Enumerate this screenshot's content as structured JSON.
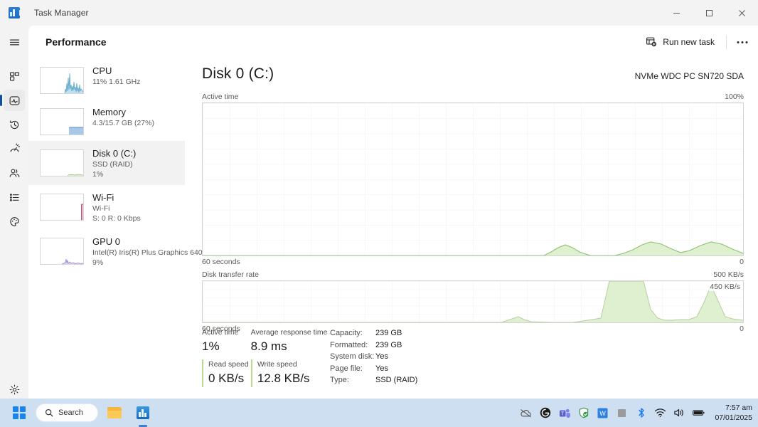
{
  "window": {
    "app_icon": "taskmanager-icon",
    "title": "Task Manager",
    "minimize": "—",
    "maximize": "☐",
    "close": "✕"
  },
  "rail": {
    "items": [
      {
        "name": "hamburger-menu",
        "icon": "hamburger-icon",
        "selected": false
      },
      {
        "name": "processes",
        "icon": "processes-icon",
        "selected": false
      },
      {
        "name": "performance",
        "icon": "performance-icon",
        "selected": true
      },
      {
        "name": "app-history",
        "icon": "history-icon",
        "selected": false
      },
      {
        "name": "startup-apps",
        "icon": "gauge-icon",
        "selected": false
      },
      {
        "name": "users",
        "icon": "users-icon",
        "selected": false
      },
      {
        "name": "details",
        "icon": "list-icon",
        "selected": false
      },
      {
        "name": "services",
        "icon": "services-gear-icon",
        "selected": false
      }
    ],
    "settings": {
      "name": "settings",
      "icon": "settings-gear-icon"
    }
  },
  "header": {
    "page_title": "Performance",
    "run_new_task_label": "Run new task",
    "run_new_task_icon": "new-task-icon",
    "more_options_icon": "more-dots-icon"
  },
  "devices": [
    {
      "name": "CPU",
      "sub1": "11%  1.61 GHz",
      "sub2": "",
      "selected": false,
      "color": "#6fb8d8"
    },
    {
      "name": "Memory",
      "sub1": "4.3/15.7 GB (27%)",
      "sub2": "",
      "selected": false,
      "color": "#7aa7d9"
    },
    {
      "name": "Disk 0 (C:)",
      "sub1": "SSD (RAID)",
      "sub2": "1%",
      "selected": true,
      "color": "#8ec06c"
    },
    {
      "name": "Wi-Fi",
      "sub1": "Wi-Fi",
      "sub2": "S: 0 R: 0 Kbps",
      "selected": false,
      "color": "#c0527f"
    },
    {
      "name": "GPU 0",
      "sub1": "Intel(R) Iris(R) Plus Graphics 640",
      "sub2": "9%",
      "selected": false,
      "color": "#9b7fd4"
    }
  ],
  "main": {
    "title": "Disk 0 (C:)",
    "model": "NVMe WDC PC SN720 SDA",
    "active_graph": {
      "caption_left": "Active time",
      "caption_right": "100%",
      "foot_left": "60 seconds",
      "foot_right": "0"
    },
    "transfer_graph": {
      "caption_left": "Disk transfer rate",
      "caption_right": "500 KB/s",
      "inner_label": "450 KB/s",
      "foot_left": "60 seconds",
      "foot_right": "0"
    }
  },
  "stats": {
    "active_time_label": "Active time",
    "active_time_value": "1%",
    "avg_response_label": "Average response time",
    "avg_response_value": "8.9 ms",
    "read_speed_label": "Read speed",
    "read_speed_value": "0 KB/s",
    "write_speed_label": "Write speed",
    "write_speed_value": "12.8 KB/s",
    "specs": [
      {
        "key": "Capacity:",
        "value": "239 GB"
      },
      {
        "key": "Formatted:",
        "value": "239 GB"
      },
      {
        "key": "System disk:",
        "value": "Yes"
      },
      {
        "key": "Page file:",
        "value": "Yes"
      },
      {
        "key": "Type:",
        "value": "SSD (RAID)"
      }
    ]
  },
  "chart_data": [
    {
      "type": "area",
      "title": "Active time",
      "ylabel": "%",
      "xlabel": "60 seconds",
      "ylim": [
        0,
        100
      ],
      "grid": true,
      "series": [
        {
          "name": "Active time",
          "color": "#8ec06c",
          "values": [
            0,
            0,
            0,
            0,
            0,
            0,
            0,
            0,
            0,
            0,
            0,
            0,
            0,
            0,
            0,
            0,
            0,
            0,
            0,
            0,
            0,
            0,
            0,
            0,
            0,
            0,
            0,
            0,
            0,
            0,
            0,
            0,
            0,
            0,
            0,
            0,
            0,
            0,
            0,
            0,
            0,
            0,
            0,
            0,
            0,
            0,
            2,
            5,
            7,
            5,
            2,
            0,
            0,
            1,
            2,
            3,
            6,
            9,
            8,
            5,
            3,
            2,
            2,
            4,
            7,
            9,
            8,
            5,
            3,
            2,
            1,
            0
          ]
        }
      ]
    },
    {
      "type": "area",
      "title": "Disk transfer rate",
      "ylabel": "KB/s",
      "xlabel": "60 seconds",
      "ylim": [
        0,
        500
      ],
      "annotation": "450 KB/s",
      "grid": true,
      "series": [
        {
          "name": "Disk transfer rate",
          "color": "#8ec06c",
          "values": [
            0,
            0,
            0,
            0,
            0,
            0,
            0,
            0,
            0,
            0,
            0,
            0,
            0,
            0,
            0,
            0,
            0,
            0,
            0,
            0,
            0,
            0,
            0,
            0,
            0,
            0,
            0,
            0,
            0,
            0,
            0,
            0,
            0,
            0,
            0,
            0,
            0,
            0,
            0,
            0,
            0,
            0,
            30,
            60,
            30,
            5,
            0,
            0,
            0,
            5,
            10,
            15,
            20,
            500,
            500,
            500,
            330,
            60,
            15,
            10,
            10,
            12,
            12,
            30,
            200,
            450,
            250,
            60,
            25,
            20,
            15,
            0
          ]
        }
      ]
    }
  ],
  "taskbar": {
    "start": "start-button",
    "search_label": "Search",
    "search_icon": "search-icon",
    "apps": [
      {
        "name": "file-explorer",
        "icon": "folder-icon",
        "active": false
      },
      {
        "name": "task-manager",
        "icon": "taskmanager-icon",
        "active": true
      }
    ],
    "tray": [
      {
        "name": "onedrive",
        "icon": "cloud-icon"
      },
      {
        "name": "grammarly",
        "icon": "grammarly-icon"
      },
      {
        "name": "teams",
        "icon": "teams-icon"
      },
      {
        "name": "security",
        "icon": "shield-icon"
      },
      {
        "name": "wps-office",
        "icon": "wps-icon"
      },
      {
        "name": "tray-overflow",
        "icon": "square-icon"
      },
      {
        "name": "bluetooth",
        "icon": "bluetooth-icon"
      },
      {
        "name": "network",
        "icon": "wifi-icon"
      },
      {
        "name": "volume",
        "icon": "speaker-icon"
      },
      {
        "name": "battery",
        "icon": "battery-icon"
      }
    ],
    "time": "7:57 am",
    "date": "07/01/2025"
  }
}
